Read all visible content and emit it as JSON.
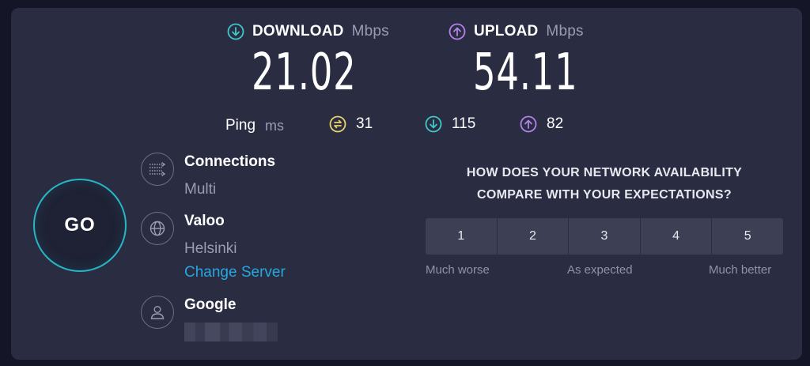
{
  "download": {
    "label": "DOWNLOAD",
    "unit": "Mbps",
    "value": "21.02",
    "icon": "download-arrow-icon",
    "color": "#3ec9c9"
  },
  "upload": {
    "label": "UPLOAD",
    "unit": "Mbps",
    "value": "54.11",
    "icon": "upload-arrow-icon",
    "color": "#b383e8"
  },
  "ping": {
    "label": "Ping",
    "unit": "ms",
    "idle": "31",
    "download": "115",
    "upload": "82",
    "colors": {
      "idle": "#e8d46b",
      "download": "#3ec9c9",
      "upload": "#b383e8"
    }
  },
  "go_button": {
    "label": "GO",
    "accent": "#27b6c4"
  },
  "connections": {
    "title": "Connections",
    "value": "Multi",
    "icon": "connections-icon"
  },
  "server": {
    "name": "Valoo",
    "location": "Helsinki",
    "change_link": "Change Server",
    "icon": "globe-icon"
  },
  "provider": {
    "name": "Google",
    "icon": "user-icon"
  },
  "survey": {
    "question_line1": "HOW DOES YOUR NETWORK AVAILABILITY",
    "question_line2": "COMPARE WITH YOUR EXPECTATIONS?",
    "ratings": [
      "1",
      "2",
      "3",
      "4",
      "5"
    ],
    "scale_low": "Much worse",
    "scale_mid": "As expected",
    "scale_high": "Much better"
  }
}
